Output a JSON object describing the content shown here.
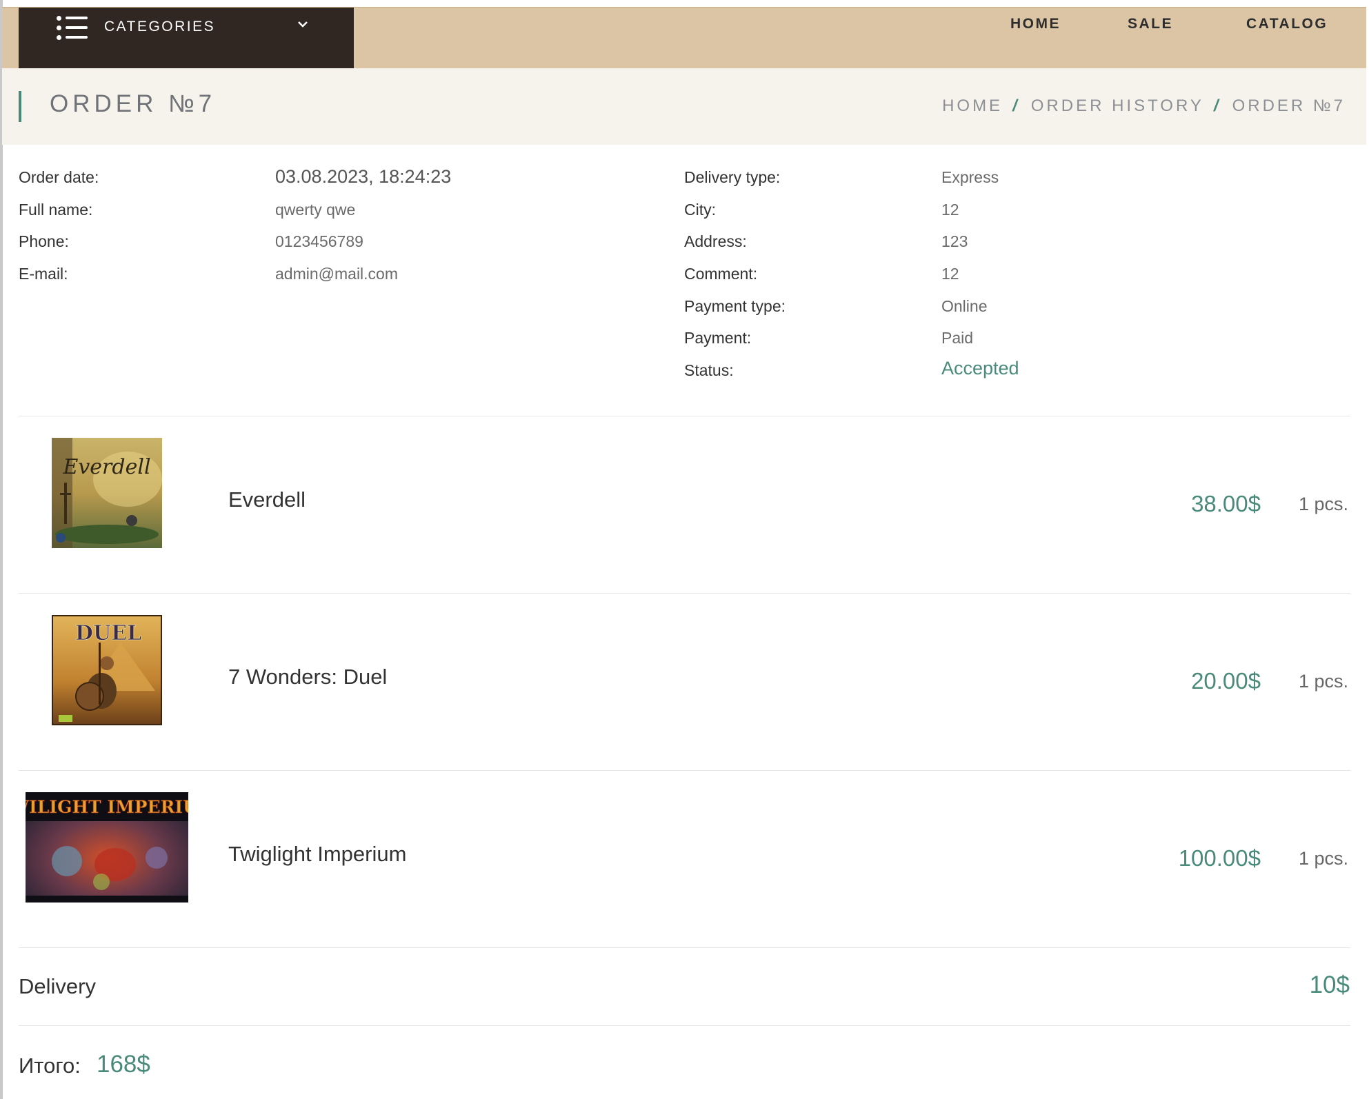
{
  "nav": {
    "categories_label": "CATEGORIES",
    "links": [
      "HOME",
      "SALE",
      "CATALOG"
    ]
  },
  "page": {
    "title": "ORDER №7",
    "breadcrumb": [
      "HOME",
      "ORDER HISTORY",
      "ORDER №7"
    ]
  },
  "order": {
    "left": [
      {
        "label": "Order date:",
        "value": "03.08.2023, 18:24:23"
      },
      {
        "label": "Full name:",
        "value": "qwerty qwe"
      },
      {
        "label": "Phone:",
        "value": "0123456789"
      },
      {
        "label": "E-mail:",
        "value": "admin@mail.com"
      }
    ],
    "right": [
      {
        "label": "Delivery type:",
        "value": "Express"
      },
      {
        "label": "City:",
        "value": "12"
      },
      {
        "label": "Address:",
        "value": "123"
      },
      {
        "label": "Comment:",
        "value": "12"
      },
      {
        "label": "Payment type:",
        "value": "Online"
      },
      {
        "label": "Payment:",
        "value": "Paid"
      },
      {
        "label": "Status:",
        "value": "Accepted"
      }
    ]
  },
  "items": [
    {
      "name": "Everdell",
      "price": "38.00$",
      "qty": "1 pcs.",
      "image_text": "Everdell"
    },
    {
      "name": "7 Wonders: Duel",
      "price": "20.00$",
      "qty": "1 pcs.",
      "image_text": "DUEL"
    },
    {
      "name": "Twiglight Imperium",
      "price": "100.00$",
      "qty": "1 pcs.",
      "image_text": "TWILIGHT IMPERIUM"
    }
  ],
  "delivery": {
    "label": "Delivery",
    "value": "10$"
  },
  "total": {
    "label": "Итого:",
    "value": "168$"
  },
  "colors": {
    "accent": "#4a8a7a",
    "nav_bg": "#dbc5a4",
    "categories_bg": "#302622",
    "header_bg": "#f6f3ed"
  }
}
